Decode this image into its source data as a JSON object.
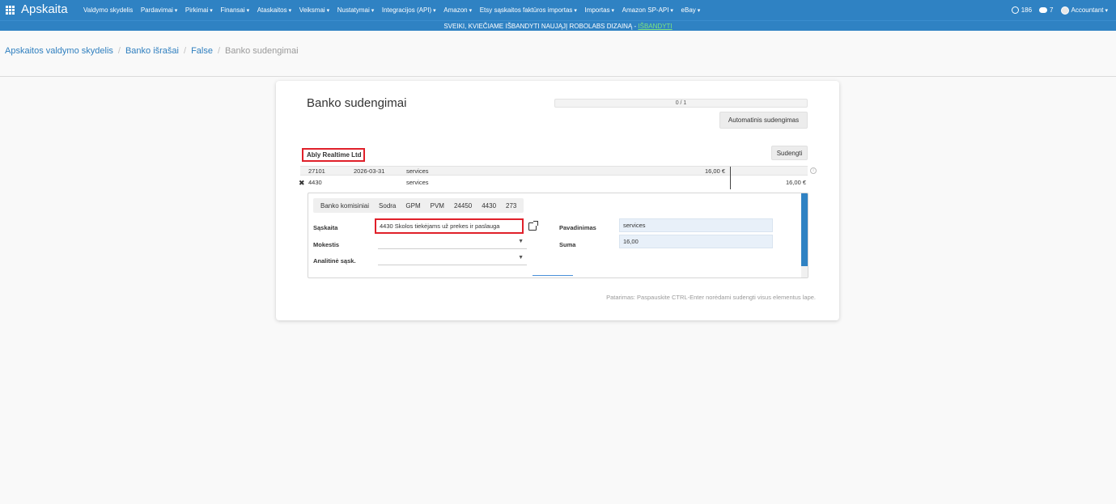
{
  "navbar": {
    "brand": "Apskaita",
    "menu": [
      {
        "label": "Valdymo skydelis",
        "caret": false
      },
      {
        "label": "Pardavimai",
        "caret": true
      },
      {
        "label": "Pirkimai",
        "caret": true
      },
      {
        "label": "Finansai",
        "caret": true
      },
      {
        "label": "Ataskaitos",
        "caret": true
      },
      {
        "label": "Veiksmai",
        "caret": true
      },
      {
        "label": "Nustatymai",
        "caret": true
      },
      {
        "label": "Integracijos (API)",
        "caret": true
      },
      {
        "label": "Amazon",
        "caret": true
      },
      {
        "label": "Etsy sąskaitos faktūros importas",
        "caret": true
      },
      {
        "label": "Importas",
        "caret": true
      },
      {
        "label": "Amazon SP-API",
        "caret": true
      },
      {
        "label": "eBay",
        "caret": true
      }
    ],
    "activity_count": "186",
    "message_count": "7",
    "user": "Accountant"
  },
  "announcement": {
    "text": "SVEIKI, KVIEČIAME IŠBANDYTI NAUJĄJĮ ROBOLABS DIZAINĄ - ",
    "link": "IŠBANDYTI"
  },
  "breadcrumb": {
    "items": [
      "Apskaitos valdymo skydelis",
      "Banko išrašai",
      "False"
    ],
    "active": "Banko sudengimai"
  },
  "reconcile": {
    "title": "Banko sudengimai",
    "progress": "0 / 1",
    "progress_fraction": 0,
    "auto_button": "Automatinis sudengimas",
    "match_button": "Sudengti",
    "partner": "Ably Realtime Ltd",
    "statement_line": {
      "ref": "27101",
      "date": "2026-03-31",
      "name": "services",
      "amount": "16,00 €"
    },
    "move_line": {
      "account": "4430",
      "name": "services",
      "amount": "16,00 €"
    },
    "quick_buttons": [
      "Banko komisiniai",
      "Sodra",
      "GPM",
      "PVM",
      "24450",
      "4430",
      "273"
    ],
    "form": {
      "account_label": "Sąskaita",
      "account_value": "4430 Skolos tiekėjams už prekes ir paslauga",
      "tax_label": "Mokestis",
      "tax_value": "",
      "analytic_label": "Analitinė sąsk.",
      "analytic_value": "",
      "name_label": "Pavadinimas",
      "name_value": "services",
      "amount_label": "Suma",
      "amount_value": "16,00"
    },
    "hint": "Patarimas: Paspauskite CTRL-Enter norėdami sudengti visus elementus lape."
  },
  "colors": {
    "navbar": "#2f82c3",
    "highlight": "#e0202a",
    "link": "#2f7fbf"
  }
}
